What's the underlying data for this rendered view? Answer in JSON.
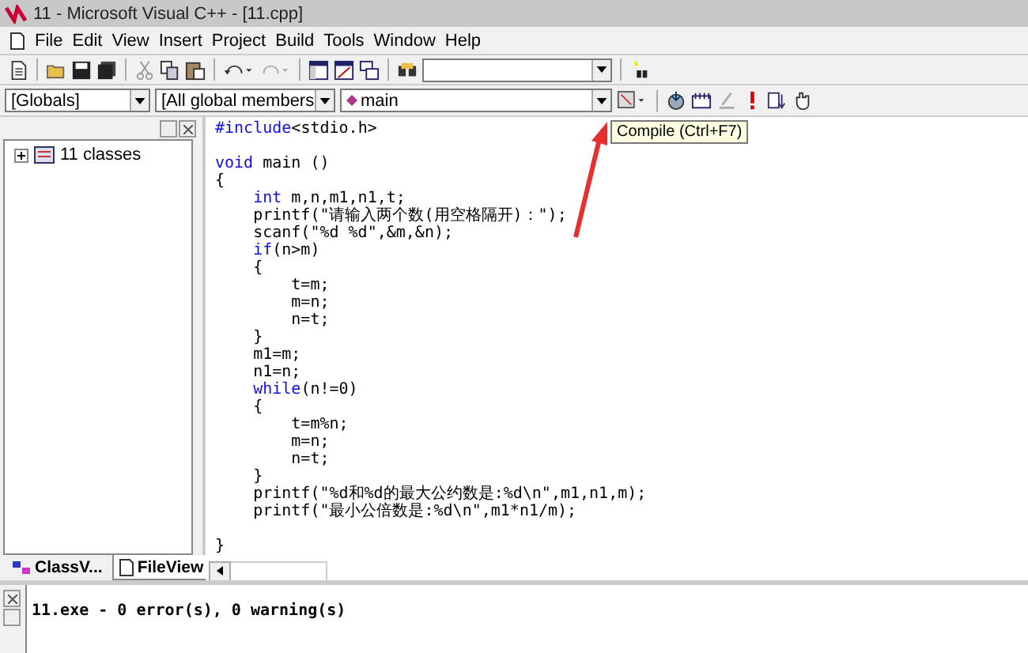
{
  "window": {
    "title": "11 - Microsoft Visual C++ - [11.cpp]"
  },
  "menu": [
    "File",
    "Edit",
    "View",
    "Insert",
    "Project",
    "Build",
    "Tools",
    "Window",
    "Help"
  ],
  "wizard_bar": {
    "class_combo": "[Globals]",
    "filter_combo": "[All global members",
    "member_combo": "main"
  },
  "tooltip": "Compile (Ctrl+F7)",
  "workspace": {
    "tree": [
      {
        "label": "11 classes",
        "expanded": false
      }
    ],
    "tabs": [
      {
        "label": "ClassV...",
        "selected": false
      },
      {
        "label": "FileView",
        "selected": true
      }
    ]
  },
  "editor": {
    "lines": [
      {
        "keyword": "#include",
        "text": "<stdio.h>",
        "space_after": true
      },
      {
        "keyword": "void",
        "text": " main ()"
      },
      {
        "text": "{",
        "children": [
          {
            "keyword": "int",
            "text": " m,n,m1,n1,t;"
          },
          {
            "text": "printf(\"请输入两个数(用空格隔开)：\");"
          },
          {
            "text": "scanf(\"%d %d\",&m,&n);"
          },
          {
            "keyword": "if",
            "text": "(n>m)"
          },
          {
            "text": "{",
            "children": [
              {
                "text": "t=m;"
              },
              {
                "text": "m=n;"
              },
              {
                "text": "n=t;"
              }
            ]
          },
          {
            "text": "}"
          },
          {
            "text": "m1=m;"
          },
          {
            "text": "n1=n;"
          },
          {
            "keyword": "while",
            "text": "(n!=0)"
          },
          {
            "text": "{",
            "children": [
              {
                "text": "t=m%n;"
              },
              {
                "text": "m=n;"
              },
              {
                "text": "n=t;"
              }
            ]
          },
          {
            "text": "}"
          },
          {
            "text": "printf(\"%d和%d的最大公约数是:%d\\n\",m1,n1,m);"
          },
          {
            "text": "printf(\"最小公倍数是:%d\\n\",m1*n1/m);",
            "space_after": true
          }
        ]
      },
      {
        "text": "}"
      }
    ]
  },
  "output": {
    "lines": [
      "11.exe - 0 error(s), 0 warning(s)"
    ]
  }
}
